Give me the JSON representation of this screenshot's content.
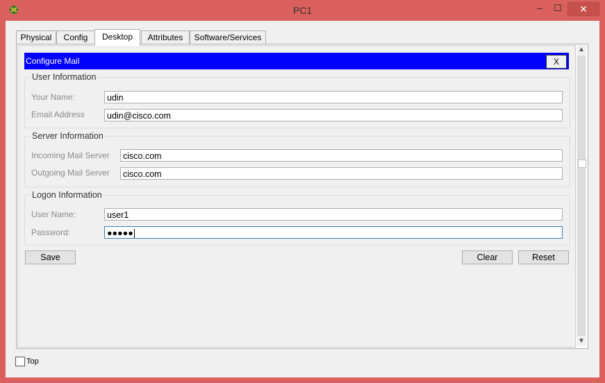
{
  "window": {
    "title": "PC1",
    "minimize_label": "–",
    "maximize_label": "☐",
    "close_label": "✕"
  },
  "tabs": [
    {
      "label": "Physical"
    },
    {
      "label": "Config"
    },
    {
      "label": "Desktop"
    },
    {
      "label": "Attributes"
    },
    {
      "label": "Software/Services"
    }
  ],
  "active_tab": "Desktop",
  "configure_mail": {
    "header": "Configure Mail",
    "close_label": "X",
    "user_info": {
      "title": "User Information",
      "your_name_label": "Your Name:",
      "your_name_value": "udin",
      "email_label": "Email Address",
      "email_value": "udin@cisco.com"
    },
    "server_info": {
      "title": "Server Information",
      "incoming_label": "Incoming Mail Server",
      "incoming_value": "cisco.com",
      "outgoing_label": "Outgoing Mail Server",
      "outgoing_value": "cisco.com"
    },
    "logon_info": {
      "title": "Logon Information",
      "username_label": "User Name:",
      "username_value": "user1",
      "password_label": "Password:",
      "password_value": "●●●●●"
    },
    "buttons": {
      "save": "Save",
      "clear": "Clear",
      "reset": "Reset"
    }
  },
  "footer": {
    "top_checkbox_label": "Top",
    "top_checked": false
  },
  "colors": {
    "window_frame": "#d9605d",
    "header_bar": "#0000ff",
    "close_button": "#c7504c"
  }
}
